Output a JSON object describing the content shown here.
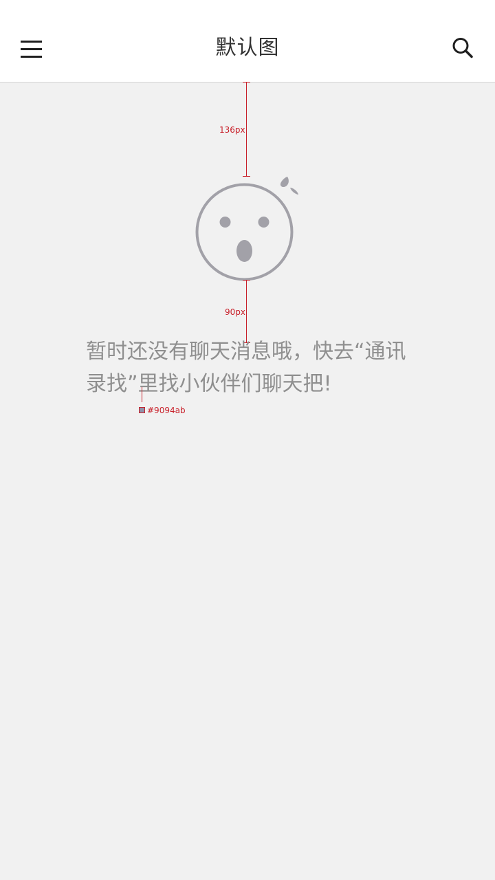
{
  "header": {
    "title": "默认图",
    "menu_icon": "hamburger-menu-icon",
    "search_icon": "search-icon"
  },
  "empty_state": {
    "illustration_icon": "surprised-face-icon",
    "message": "暂时还没有聊天消息哦，快去“通讯录找”里找小伙伴们聊天把!"
  },
  "annotations": {
    "top_spacing": "136px",
    "bottom_spacing": "90px",
    "text_color_label": "#9094ab"
  },
  "colors": {
    "background": "#f1f1f1",
    "header_background": "#ffffff",
    "text_color": "#9094ab",
    "icon_color": "#a2a1a8",
    "annotation_color": "#c8202a"
  }
}
